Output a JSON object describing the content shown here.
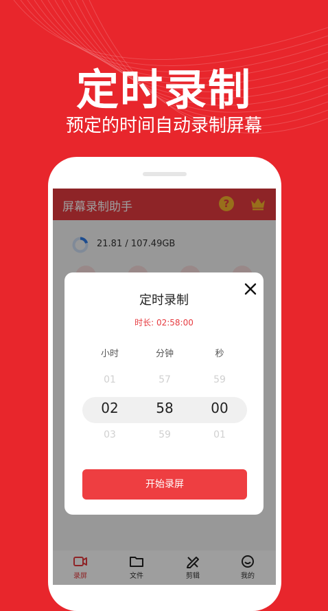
{
  "hero": {
    "title": "定时录制",
    "subtitle": "预定的时间自动录制屏幕"
  },
  "app": {
    "title": "屏幕录制助手",
    "help_label": "?",
    "storage": "21.81 / 107.49GB",
    "storage_used_fraction": 0.203
  },
  "tabs": [
    {
      "label": "录屏",
      "icon": "video-icon",
      "active": true
    },
    {
      "label": "文件",
      "icon": "folder-icon",
      "active": false
    },
    {
      "label": "剪辑",
      "icon": "edit-icon",
      "active": false
    },
    {
      "label": "我的",
      "icon": "smile-icon",
      "active": false
    }
  ],
  "dialog": {
    "title": "定时录制",
    "duration": "时长: 02:58:00",
    "columns": [
      "小时",
      "分钟",
      "秒"
    ],
    "wheels": [
      {
        "prev": "01",
        "current": "02",
        "next": "03"
      },
      {
        "prev": "57",
        "current": "58",
        "next": "59"
      },
      {
        "prev": "59",
        "current": "00",
        "next": "01"
      }
    ],
    "start_label": "开始录屏"
  },
  "colors": {
    "background": "#e8262c",
    "accent": "#e63a3f",
    "crown": "#f5b32c"
  }
}
